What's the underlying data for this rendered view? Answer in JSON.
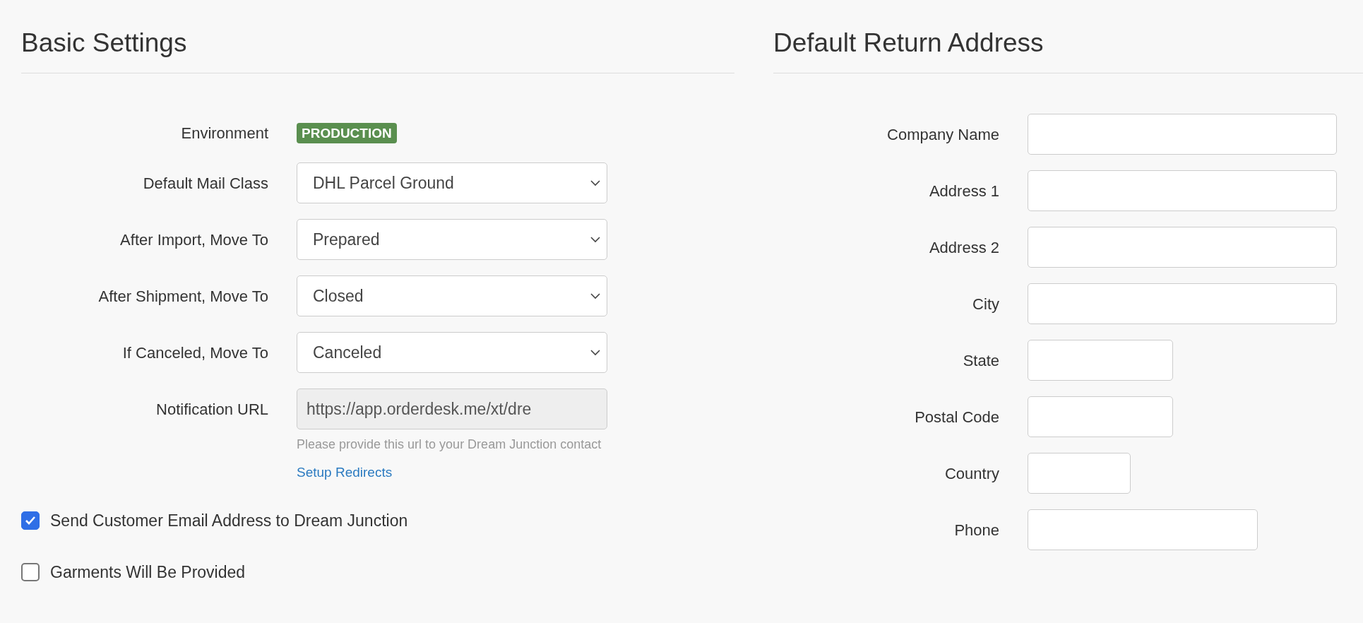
{
  "basic_settings": {
    "title": "Basic Settings",
    "fields": [
      {
        "kind": "badge",
        "label": "Environment",
        "value": "PRODUCTION"
      },
      {
        "kind": "select",
        "label": "Default Mail Class",
        "value": "DHL Parcel Ground"
      },
      {
        "kind": "select",
        "label": "After Import, Move To",
        "value": "Prepared"
      },
      {
        "kind": "select",
        "label": "After Shipment, Move To",
        "value": "Closed"
      },
      {
        "kind": "select",
        "label": "If Canceled, Move To",
        "value": "Canceled"
      },
      {
        "kind": "readonly",
        "label": "Notification URL",
        "value": "https://app.orderdesk.me/xt/dre",
        "help": "Please provide this url to your Dream Junction contact",
        "link": "Setup Redirects"
      }
    ],
    "checkboxes": [
      {
        "label": "Send Customer Email Address to Dream Junction",
        "checked": true
      },
      {
        "label": "Garments Will Be Provided",
        "checked": false
      }
    ]
  },
  "return_address": {
    "title": "Default Return Address",
    "fields": [
      {
        "label": "Company Name"
      },
      {
        "label": "Address 1"
      },
      {
        "label": "Address 2"
      },
      {
        "label": "City"
      },
      {
        "label": "State"
      },
      {
        "label": "Postal Code"
      },
      {
        "label": "Country"
      },
      {
        "label": "Phone"
      }
    ]
  }
}
